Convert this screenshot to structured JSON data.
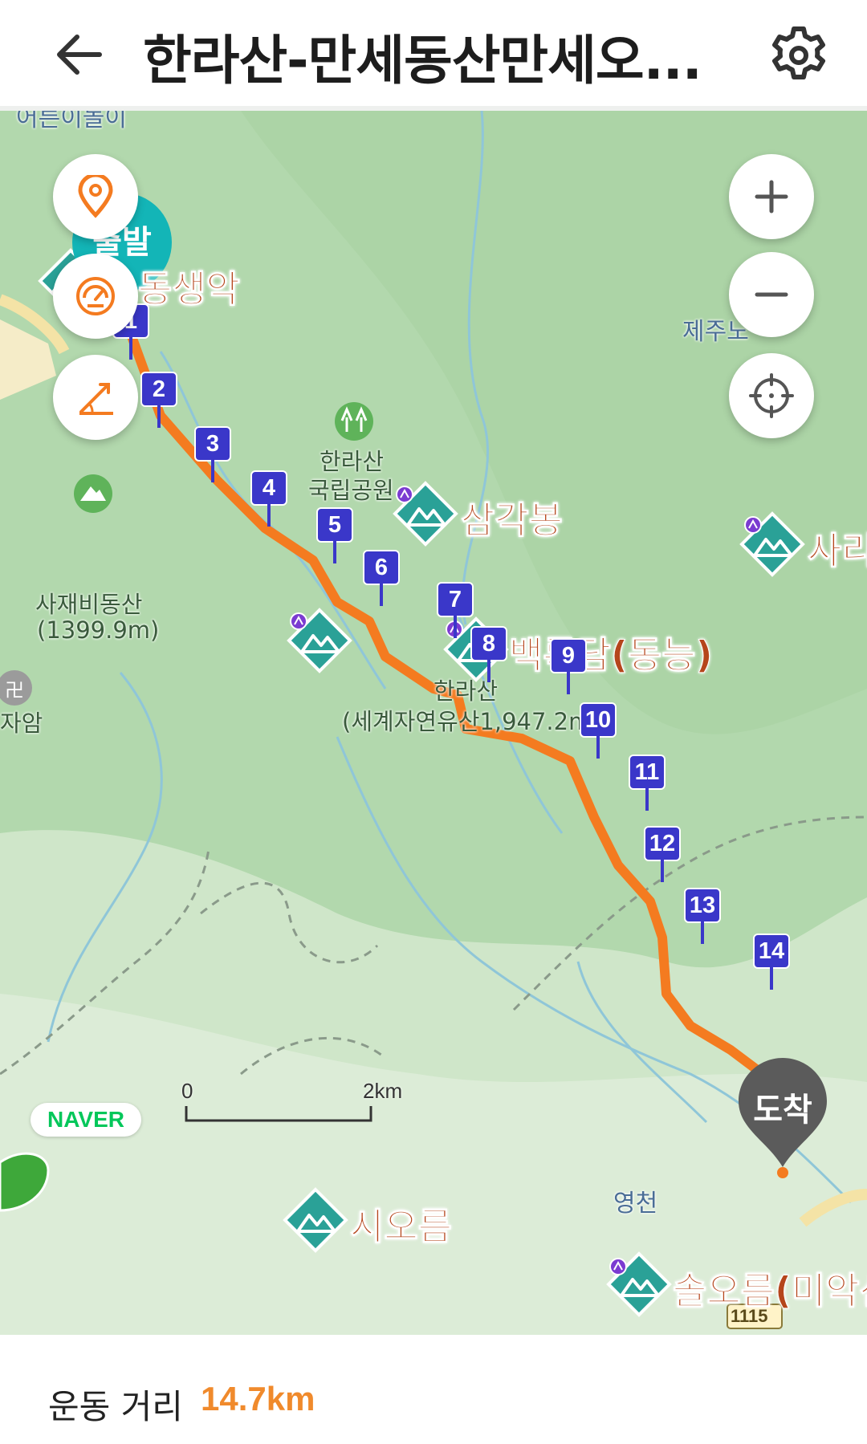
{
  "header": {
    "title": "한라산-만세동산만세오..."
  },
  "map": {
    "start_label": "출발",
    "end_label": "도착",
    "peak_labels": {
      "dongsaeng": "동생악",
      "samgak": "삼각봉",
      "baengnok": "백록담(동능)",
      "sari": "사리",
      "sioreum": "시오름",
      "soloreum": "솔오름(미악산"
    },
    "place_labels": {
      "park_line1": "한라산",
      "park_line2": "국립공원",
      "sajaebi_line1": "사재비동산",
      "sajaebi_line2": "(1399.9m)",
      "hallasan_line1": "한라산",
      "hallasan_line2": "(세계자연유산1,947.2m)",
      "jeju": "제주노",
      "temple": "자암",
      "top_left": "어른이놀이",
      "yeongcheon": "영천",
      "road": "1115"
    },
    "waypoints": [
      "1",
      "2",
      "3",
      "4",
      "5",
      "6",
      "7",
      "8",
      "9",
      "10",
      "11",
      "12",
      "13",
      "14"
    ],
    "scale": {
      "zero": "0",
      "max": "2km"
    },
    "brand": "NAVER",
    "route_color": "#f47b20",
    "waypoint_color": "#3a37c9"
  },
  "stats": {
    "distance_label": "운동 거리",
    "distance_value": "14.7km"
  }
}
